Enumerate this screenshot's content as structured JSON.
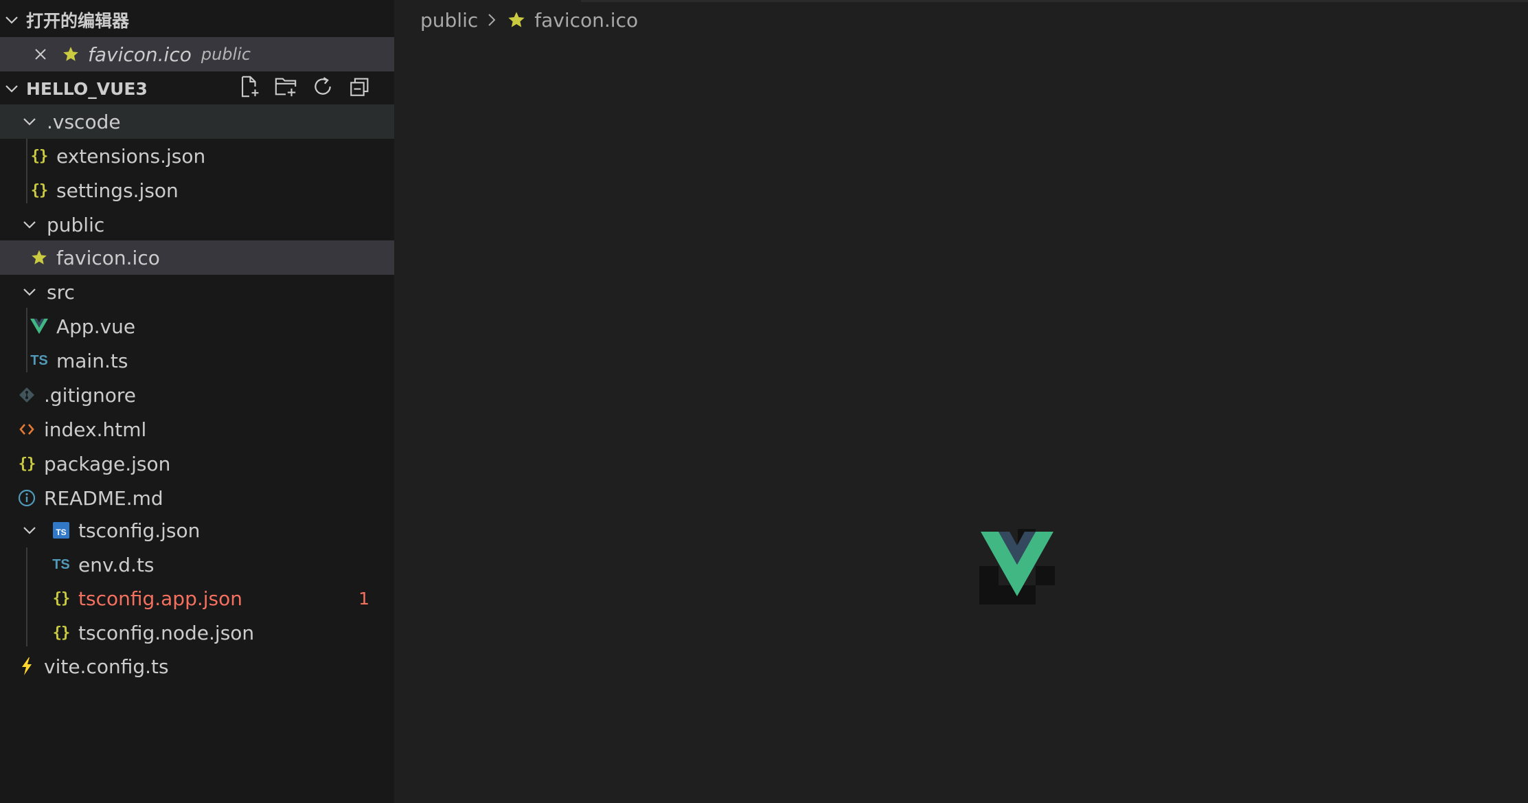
{
  "open_editors": {
    "title": "打开的编辑器",
    "item": {
      "name": "favicon.ico",
      "folder": "public"
    }
  },
  "explorer": {
    "title": "HELLO_VUE3",
    "toolbar": [
      "new-file-icon",
      "new-folder-icon",
      "refresh-icon",
      "collapse-all-icon"
    ],
    "tree": [
      {
        "label": ".vscode",
        "type": "folder"
      },
      {
        "label": "extensions.json",
        "type": "json"
      },
      {
        "label": "settings.json",
        "type": "json"
      },
      {
        "label": "public",
        "type": "folder"
      },
      {
        "label": "favicon.ico",
        "type": "favicon"
      },
      {
        "label": "src",
        "type": "folder"
      },
      {
        "label": "App.vue",
        "type": "vue"
      },
      {
        "label": "main.ts",
        "type": "ts"
      },
      {
        "label": ".gitignore",
        "type": "git"
      },
      {
        "label": "index.html",
        "type": "html"
      },
      {
        "label": "package.json",
        "type": "json"
      },
      {
        "label": "README.md",
        "type": "info"
      },
      {
        "label": "tsconfig.json",
        "type": "tsconfig"
      },
      {
        "label": "env.d.ts",
        "type": "ts"
      },
      {
        "label": "tsconfig.app.json",
        "type": "json",
        "problems": "1"
      },
      {
        "label": "tsconfig.node.json",
        "type": "json"
      },
      {
        "label": "vite.config.ts",
        "type": "vite"
      }
    ]
  },
  "breadcrumb": {
    "folder": "public",
    "file": "favicon.ico"
  },
  "colors": {
    "json": "#cbcb41",
    "ts": "#519aba",
    "vue": "#41b883",
    "html": "#e37933",
    "error": "#f4705f",
    "star": "#cbcb41"
  }
}
